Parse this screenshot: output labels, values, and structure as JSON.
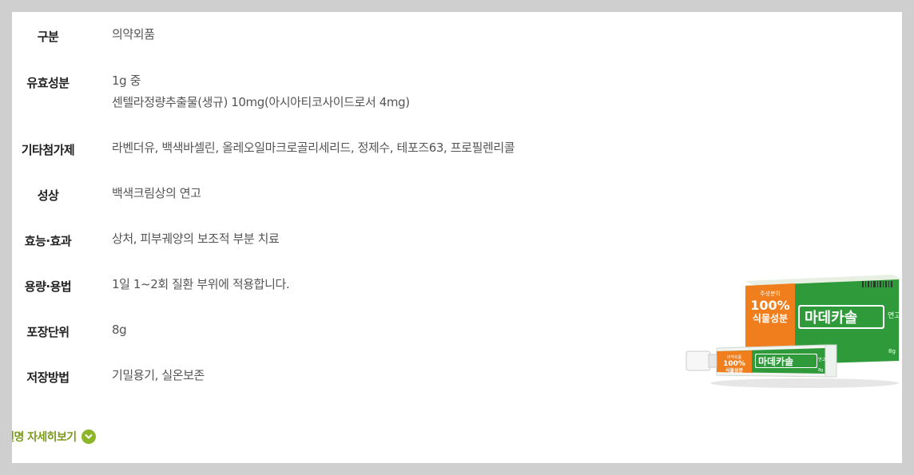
{
  "spec": [
    {
      "label": "구분",
      "lines": [
        "의약외품"
      ]
    },
    {
      "label": "유효성분",
      "lines": [
        "1g 중",
        "센텔라정량추출물(생규) 10mg(아시아티코사이드로서 4mg)"
      ]
    },
    {
      "label": "기타첨가제",
      "lines": [
        "라벤더유, 백색바셀린, 올레오일마크로골리세리드, 정제수, 테포즈63, 프로필렌리콜"
      ]
    },
    {
      "label": "성상",
      "lines": [
        "백색크림상의 연고"
      ]
    },
    {
      "label": "효능·효과",
      "lines": [
        "상처, 피부궤양의 보조적 부분 치료"
      ]
    },
    {
      "label": "용량·용법",
      "lines": [
        "1일 1~2회 질환 부위에 적용합니다."
      ]
    },
    {
      "label": "포장단위",
      "lines": [
        "8g"
      ]
    },
    {
      "label": "저장방법",
      "lines": [
        "기밀용기, 실온보존"
      ]
    }
  ],
  "more_link": {
    "label": "품설명 자세히보기",
    "icon": "chevron-down-icon"
  },
  "product": {
    "box_top_text": "주성분이",
    "box_percent": "100%",
    "box_sub": "식물성분",
    "box_brand": "마데카솔",
    "box_form": "연고",
    "box_weight": "8g",
    "tube_percent": "100%",
    "tube_sub": "식물성분",
    "tube_brand": "마데카솔",
    "tube_form": "연고",
    "tube_weight": "8g",
    "tube_top": "의약외품",
    "colors": {
      "green": "#2e9a3a",
      "orange": "#f07e1c",
      "accent": "#8db52a"
    }
  }
}
